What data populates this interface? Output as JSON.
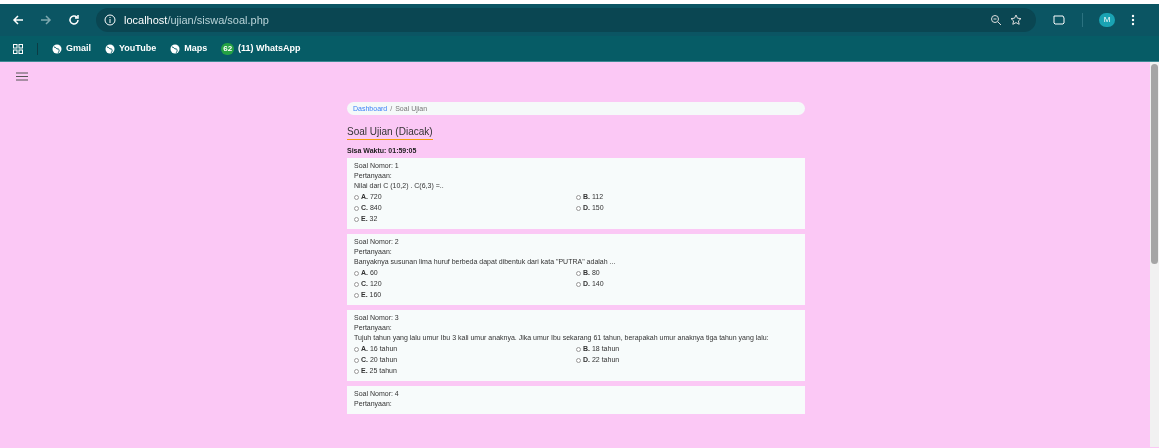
{
  "browser": {
    "url_host": "localhost",
    "url_path": "/ujian/siswa/soal.php",
    "profile_initial": "M",
    "bookmarks": [
      {
        "kind": "globe",
        "label": "Gmail"
      },
      {
        "kind": "globe",
        "label": "YouTube"
      },
      {
        "kind": "globe",
        "label": "Maps"
      },
      {
        "kind": "badge",
        "badge": "62",
        "label": "(11) WhatsApp"
      }
    ]
  },
  "breadcrumb": {
    "link": "Dashboard",
    "separator": "/",
    "current": "Soal Ujian"
  },
  "title": "Soal Ujian (Diacak)",
  "timer": "Sisa Waktu: 01:59:05",
  "questions": [
    {
      "number": "Soal Nomor: 1",
      "label": "Pertanyaan:",
      "text": "Nilai dari C (10,2) . C(6,3) =..",
      "options": [
        {
          "text": "**A.** 720",
          "selected": false
        },
        {
          "text": "**B.** 112",
          "selected": false
        },
        {
          "text": "**C.** 840",
          "selected": false
        },
        {
          "text": "**D.** 150",
          "selected": false
        },
        {
          "text": "**E.** 32",
          "selected": false
        }
      ]
    },
    {
      "number": "Soal Nomor: 2",
      "label": "Pertanyaan:",
      "text": "Banyaknya susunan lima huruf berbeda dapat dibentuk dari kata \"PUTRA\" adalah ...",
      "options": [
        {
          "text": "**A.** 60",
          "selected": false
        },
        {
          "text": "**B.** 80",
          "selected": false
        },
        {
          "text": "**C.** 120",
          "selected": false
        },
        {
          "text": "**D.** 140",
          "selected": false
        },
        {
          "text": "**E.** 160",
          "selected": false
        }
      ]
    },
    {
      "number": "Soal Nomor: 3",
      "label": "Pertanyaan:",
      "text": "Tujuh tahun yang lalu umur Ibu 3 kali umur anaknya. Jika umur Ibu sekarang 61 tahun, berapakah umur anaknya tiga tahun yang lalu:",
      "options": [
        {
          "text": "**A.** 16 tahun",
          "selected": false
        },
        {
          "text": "**B.** 18 tahun",
          "selected": false
        },
        {
          "text": "**C.** 20 tahun",
          "selected": false
        },
        {
          "text": "**D.** 22 tahun",
          "selected": false
        },
        {
          "text": "**E.** 25 tahun",
          "selected": false
        }
      ]
    },
    {
      "number": "Soal Nomor: 4",
      "label": "Pertanyaan:"
    }
  ]
}
